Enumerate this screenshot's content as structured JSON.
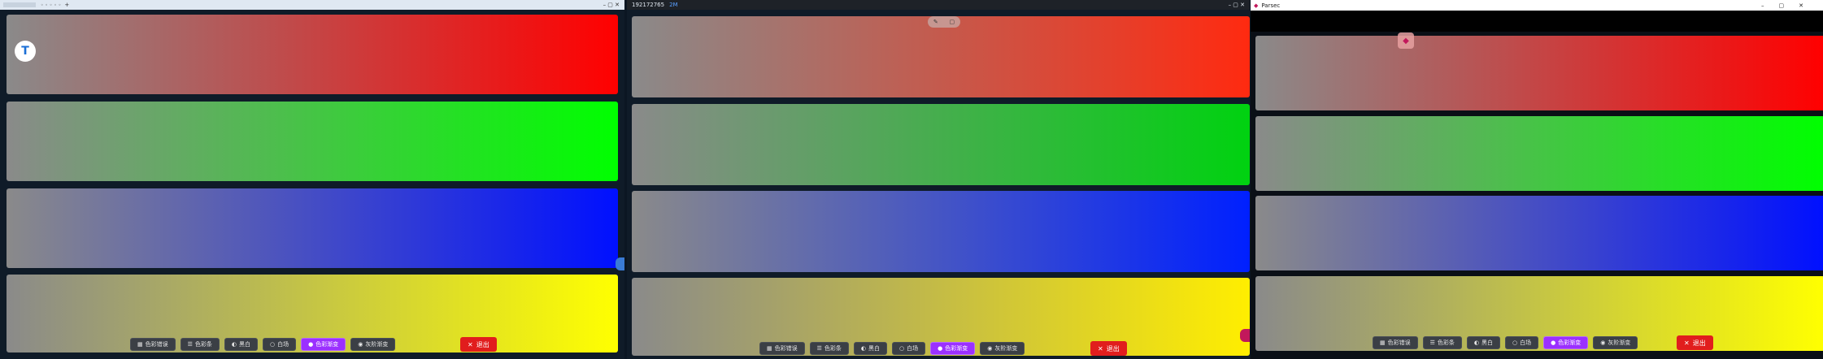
{
  "colors": {
    "red_end": "#ff0000",
    "green_end": "#00ff00",
    "blue_end": "#0010ff",
    "yellow_end": "#ffff00",
    "gray_start": "#8a8a8a",
    "accent": "#9b30ff",
    "exit": "#e11d1d"
  },
  "middle": {
    "title": "192172765",
    "badge": "2M"
  },
  "right": {
    "title": "Parsec"
  },
  "toolbar": {
    "items": [
      "色彩错误",
      "色彩条",
      "黑白",
      "白场",
      "色彩渐变",
      "灰阶渐变"
    ],
    "exit_label": "退出"
  }
}
